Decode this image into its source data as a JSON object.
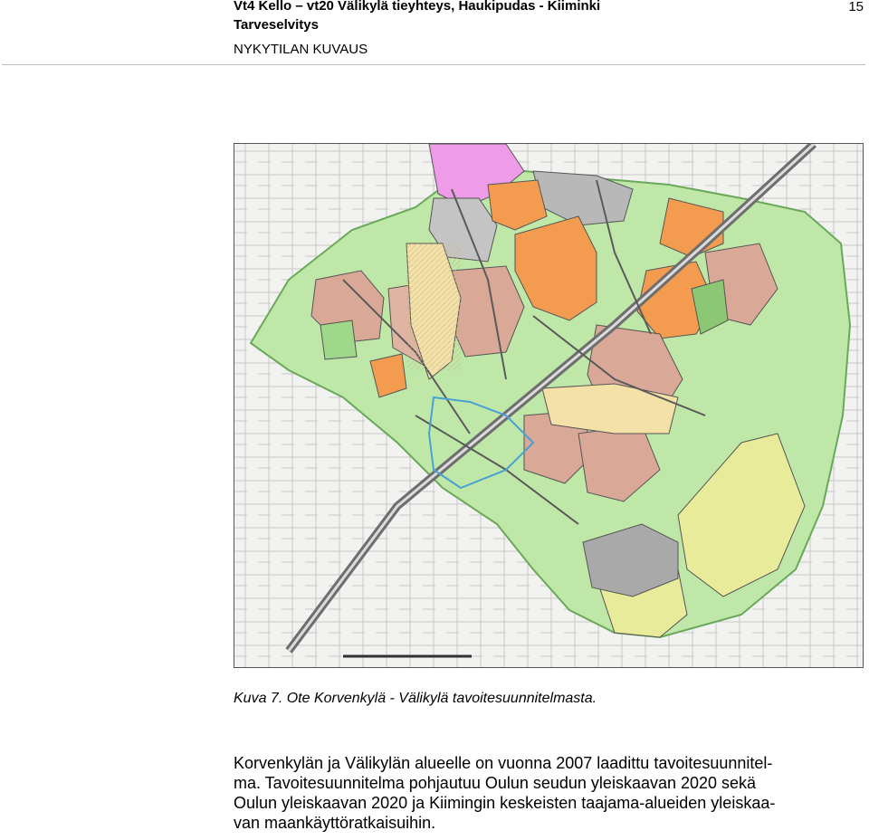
{
  "header": {
    "title": "Vt4 Kello – vt20 Välikylä tieyhteys, Haukipudas - Kiiminki",
    "subtitle": "Tarveselvitys",
    "section": "NYKYTILAN KUVAUS",
    "page_number": "15"
  },
  "figure": {
    "caption": "Kuva 7. Ote Korvenkylä - Välikylä tavoitesuunnitelmasta.",
    "colors": {
      "residential": "#d9a896",
      "residential_small": "#f4e1a8",
      "commercial": "#f39c4f",
      "green_area": "#bfe8a8",
      "recreation": "#9fd88a",
      "industrial": "#b8b8b8",
      "special": "#ee9be8",
      "agricultural": "#e8ec9a",
      "roads": "#5a5a5a",
      "boundary": "#4a9fd4"
    }
  },
  "body": {
    "lines": [
      "Korvenkylän ja Välikylän alueelle on vuonna 2007 laadittu tavoitesuunnitel-",
      "ma. Tavoitesuunnitelma pohjautuu Oulun seudun yleiskaavan 2020 sekä",
      "Oulun yleiskaavan 2020 ja Kiimingin keskeisten taajama-alueiden yleiskaa-",
      "van maankäyttöratkaisuihin."
    ]
  }
}
